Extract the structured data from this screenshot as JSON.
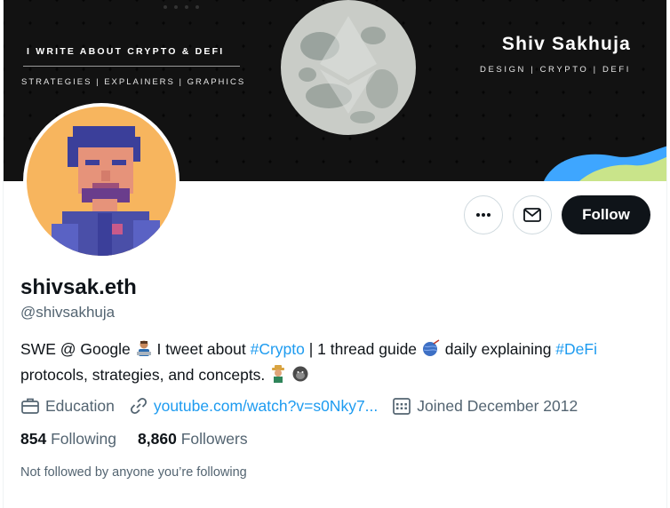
{
  "banner": {
    "left_title": "I WRITE ABOUT CRYPTO & DEFI",
    "left_subtitle": "STRATEGIES | EXPLAINERS | GRAPHICS",
    "right_title": "Shiv Sakhuja",
    "right_subtitle": "DESIGN | CRYPTO | DEFI",
    "colors": {
      "background": "#050505",
      "moon": "#c9ccc7",
      "wave_blue": "#3ea6ff",
      "wave_green": "#c9e48a"
    }
  },
  "actions": {
    "more_icon": "more-horizontal-icon",
    "message_icon": "envelope-icon",
    "follow_label": "Follow"
  },
  "profile": {
    "display_name": "shivsak.eth",
    "handle": "@shivsakhuja",
    "bio": {
      "p1": "SWE @ Google ",
      "p2": " I tweet about ",
      "hashtag1": "#Crypto",
      "p3": " | 1 thread guide ",
      "p4": " daily explaining ",
      "hashtag2": "#DeFi",
      "p5": " protocols, strategies, and concepts. ",
      "emoji_icons": [
        "technologist-emoji-icon",
        "yarn-emoji-icon",
        "farmer-emoji-icon",
        "gorilla-emoji-icon"
      ]
    },
    "category": "Education",
    "link": "youtube.com/watch?v=s0Nky7...",
    "joined": "Joined December 2012",
    "following_count": "854",
    "following_label": "Following",
    "followers_count": "8,860",
    "followers_label": "Followers",
    "not_followed_note": "Not followed by anyone you’re following"
  },
  "colors": {
    "accent": "#1d9bf0",
    "text": "#0f1419",
    "secondary": "#536471"
  }
}
